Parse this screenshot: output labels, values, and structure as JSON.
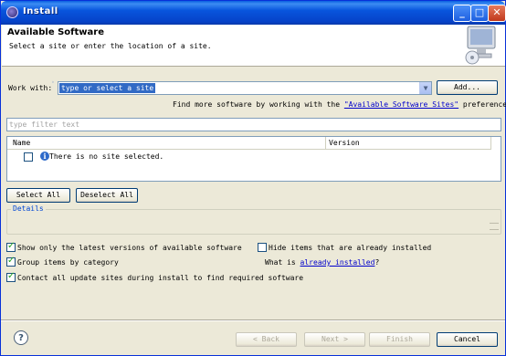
{
  "window": {
    "title": "Install"
  },
  "banner": {
    "title": "Available Software",
    "description": "Select a site or enter the location of a site."
  },
  "work_with": {
    "label": "Work with:",
    "value": "type or select a site",
    "add_button": "Add...",
    "hint_prefix": "Find more software by working with the",
    "hint_link": "\"Available Software Sites\"",
    "hint_suffix": "preferences."
  },
  "filter": {
    "placeholder": "type filter text"
  },
  "table": {
    "columns": [
      "Name",
      "Version"
    ],
    "rows": [
      {
        "name": "There is no site selected.",
        "version": ""
      }
    ]
  },
  "selection_buttons": {
    "select_all": "Select All",
    "deselect_all": "Deselect All"
  },
  "details": {
    "legend": "Details"
  },
  "options": {
    "latest_versions": {
      "label": "Show only the latest versions of available software",
      "checked": true
    },
    "hide_installed": {
      "label": "Hide items that are already installed",
      "checked": false
    },
    "group_by_category": {
      "label": "Group items by category",
      "checked": true
    },
    "contact_sites": {
      "label": "Contact all update sites during install to find required software",
      "checked": true
    },
    "what_is_prefix": "What is",
    "what_is_link": "already installed",
    "what_is_suffix": "?"
  },
  "footer": {
    "back": "< Back",
    "next": "Next >",
    "finish": "Finish",
    "cancel": "Cancel"
  },
  "colors": {
    "accent": "#316ac5",
    "link": "#0000cc",
    "title_bar": "#0855dd"
  }
}
